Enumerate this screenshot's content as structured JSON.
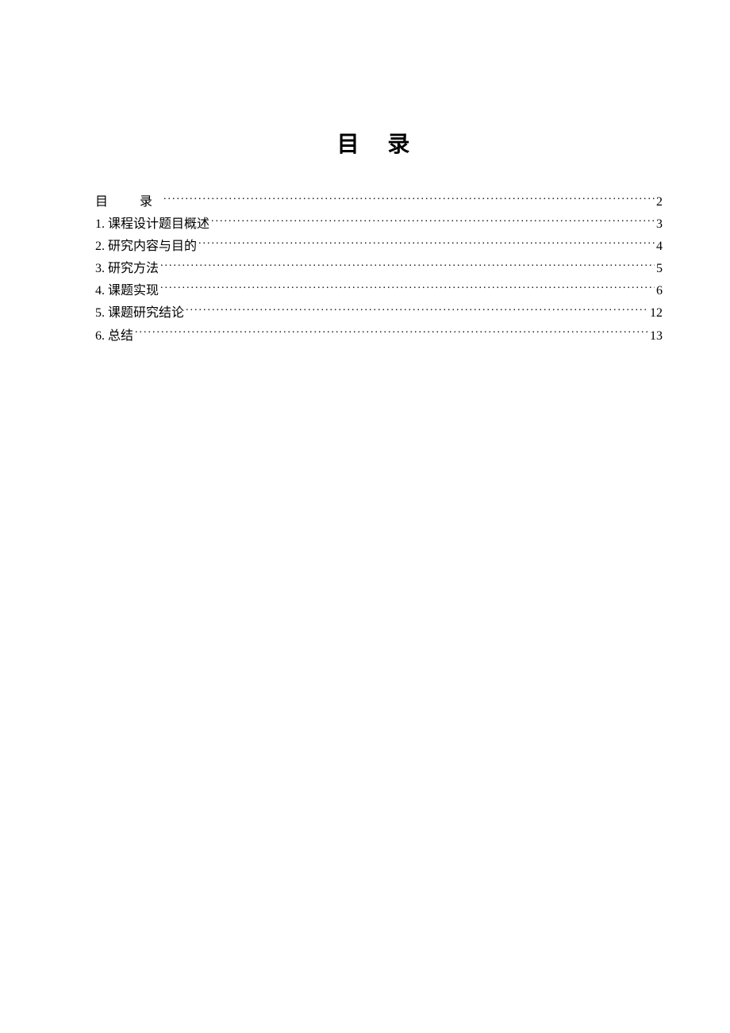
{
  "title": "目 录",
  "toc": [
    {
      "label": "目　录",
      "page": "2",
      "first": true
    },
    {
      "label": "1. 课程设计题目概述",
      "page": "3",
      "first": false
    },
    {
      "label": "2. 研究内容与目的",
      "page": "4",
      "first": false
    },
    {
      "label": "3. 研究方法",
      "page": "5",
      "first": false
    },
    {
      "label": "4. 课题实现",
      "page": "6",
      "first": false
    },
    {
      "label": "5. 课题研究结论",
      "page": "12",
      "first": false
    },
    {
      "label": "6. 总结",
      "page": "13",
      "first": false
    }
  ]
}
